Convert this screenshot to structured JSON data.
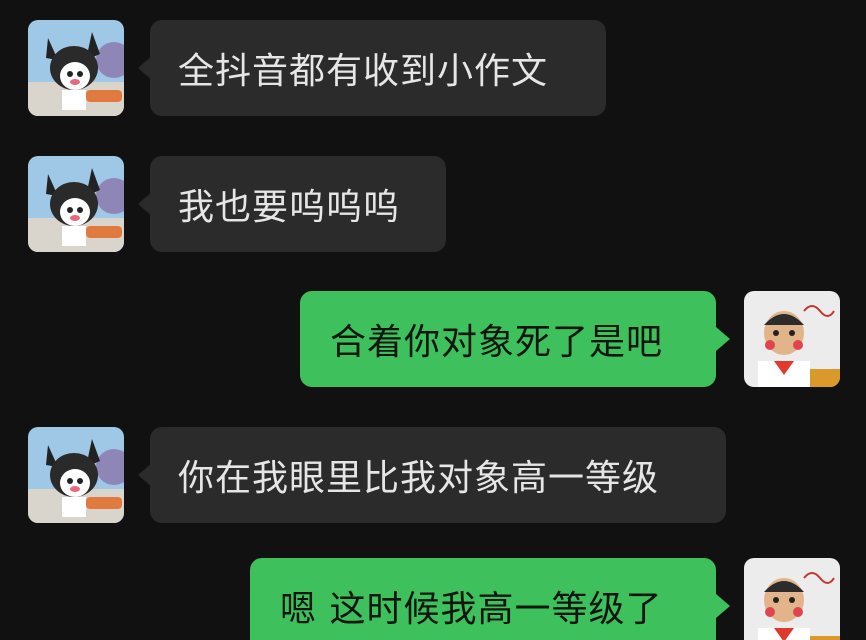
{
  "messages": [
    {
      "direction": "in",
      "text": "全抖音都有收到小作文"
    },
    {
      "direction": "in",
      "text": "我也要呜呜呜"
    },
    {
      "direction": "out",
      "text": "合着你对象死了是吧"
    },
    {
      "direction": "in",
      "text": "你在我眼里比我对象高一等级"
    },
    {
      "direction": "out",
      "text": "嗯 这时候我高一等级了"
    }
  ],
  "colors": {
    "background": "#111111",
    "incoming_bubble": "#2b2b2b",
    "outgoing_bubble": "#3ec15d",
    "incoming_text": "#e6e6e6",
    "outgoing_text": "#0f160f"
  },
  "avatars": {
    "contact": "cartoon-bunny-avatar",
    "self": "photo-avatar"
  }
}
